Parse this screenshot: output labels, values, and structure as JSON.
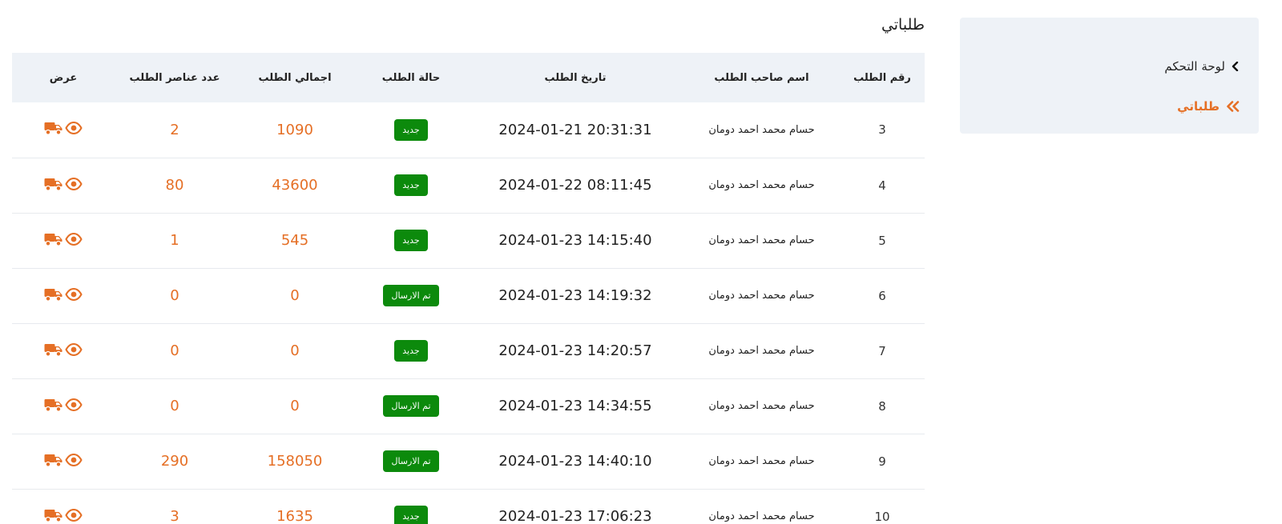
{
  "sidebar": {
    "items": [
      {
        "label": "لوحة التحكم",
        "active": false
      },
      {
        "label": "طلباتي",
        "active": true
      }
    ]
  },
  "page": {
    "title": "طلباتي"
  },
  "table": {
    "headers": {
      "order_no": "رقم الطلب",
      "owner": "اسم صاحب الطلب",
      "date": "تاريخ الطلب",
      "status": "حالة الطلب",
      "total": "اجمالي الطلب",
      "items": "عدد عناصر الطلب",
      "view": "عرض"
    },
    "rows": [
      {
        "order_no": "3",
        "owner": "حسام محمد احمد دومان",
        "date": "2024-01-21 20:31:31",
        "status": "جديد",
        "total": "1090",
        "items": "2"
      },
      {
        "order_no": "4",
        "owner": "حسام محمد احمد دومان",
        "date": "2024-01-22 08:11:45",
        "status": "جديد",
        "total": "43600",
        "items": "80"
      },
      {
        "order_no": "5",
        "owner": "حسام محمد احمد دومان",
        "date": "2024-01-23 14:15:40",
        "status": "جديد",
        "total": "545",
        "items": "1"
      },
      {
        "order_no": "6",
        "owner": "حسام محمد احمد دومان",
        "date": "2024-01-23 14:19:32",
        "status": "تم الارسال",
        "total": "0",
        "items": "0"
      },
      {
        "order_no": "7",
        "owner": "حسام محمد احمد دومان",
        "date": "2024-01-23 14:20:57",
        "status": "جديد",
        "total": "0",
        "items": "0"
      },
      {
        "order_no": "8",
        "owner": "حسام محمد احمد دومان",
        "date": "2024-01-23 14:34:55",
        "status": "تم الارسال",
        "total": "0",
        "items": "0"
      },
      {
        "order_no": "9",
        "owner": "حسام محمد احمد دومان",
        "date": "2024-01-23 14:40:10",
        "status": "تم الارسال",
        "total": "158050",
        "items": "290"
      },
      {
        "order_no": "10",
        "owner": "حسام محمد احمد دومان",
        "date": "2024-01-23 17:06:23",
        "status": "جديد",
        "total": "1635",
        "items": "3"
      }
    ]
  },
  "icons": {
    "view": "eye-icon",
    "ship": "truck-icon",
    "chevron": "chevron-left-icon",
    "double_chevron": "double-chevron-left-icon"
  },
  "colors": {
    "accent": "#e56f25",
    "status_badge": "#0c8a0c",
    "panel_bg": "#eef2f7"
  }
}
